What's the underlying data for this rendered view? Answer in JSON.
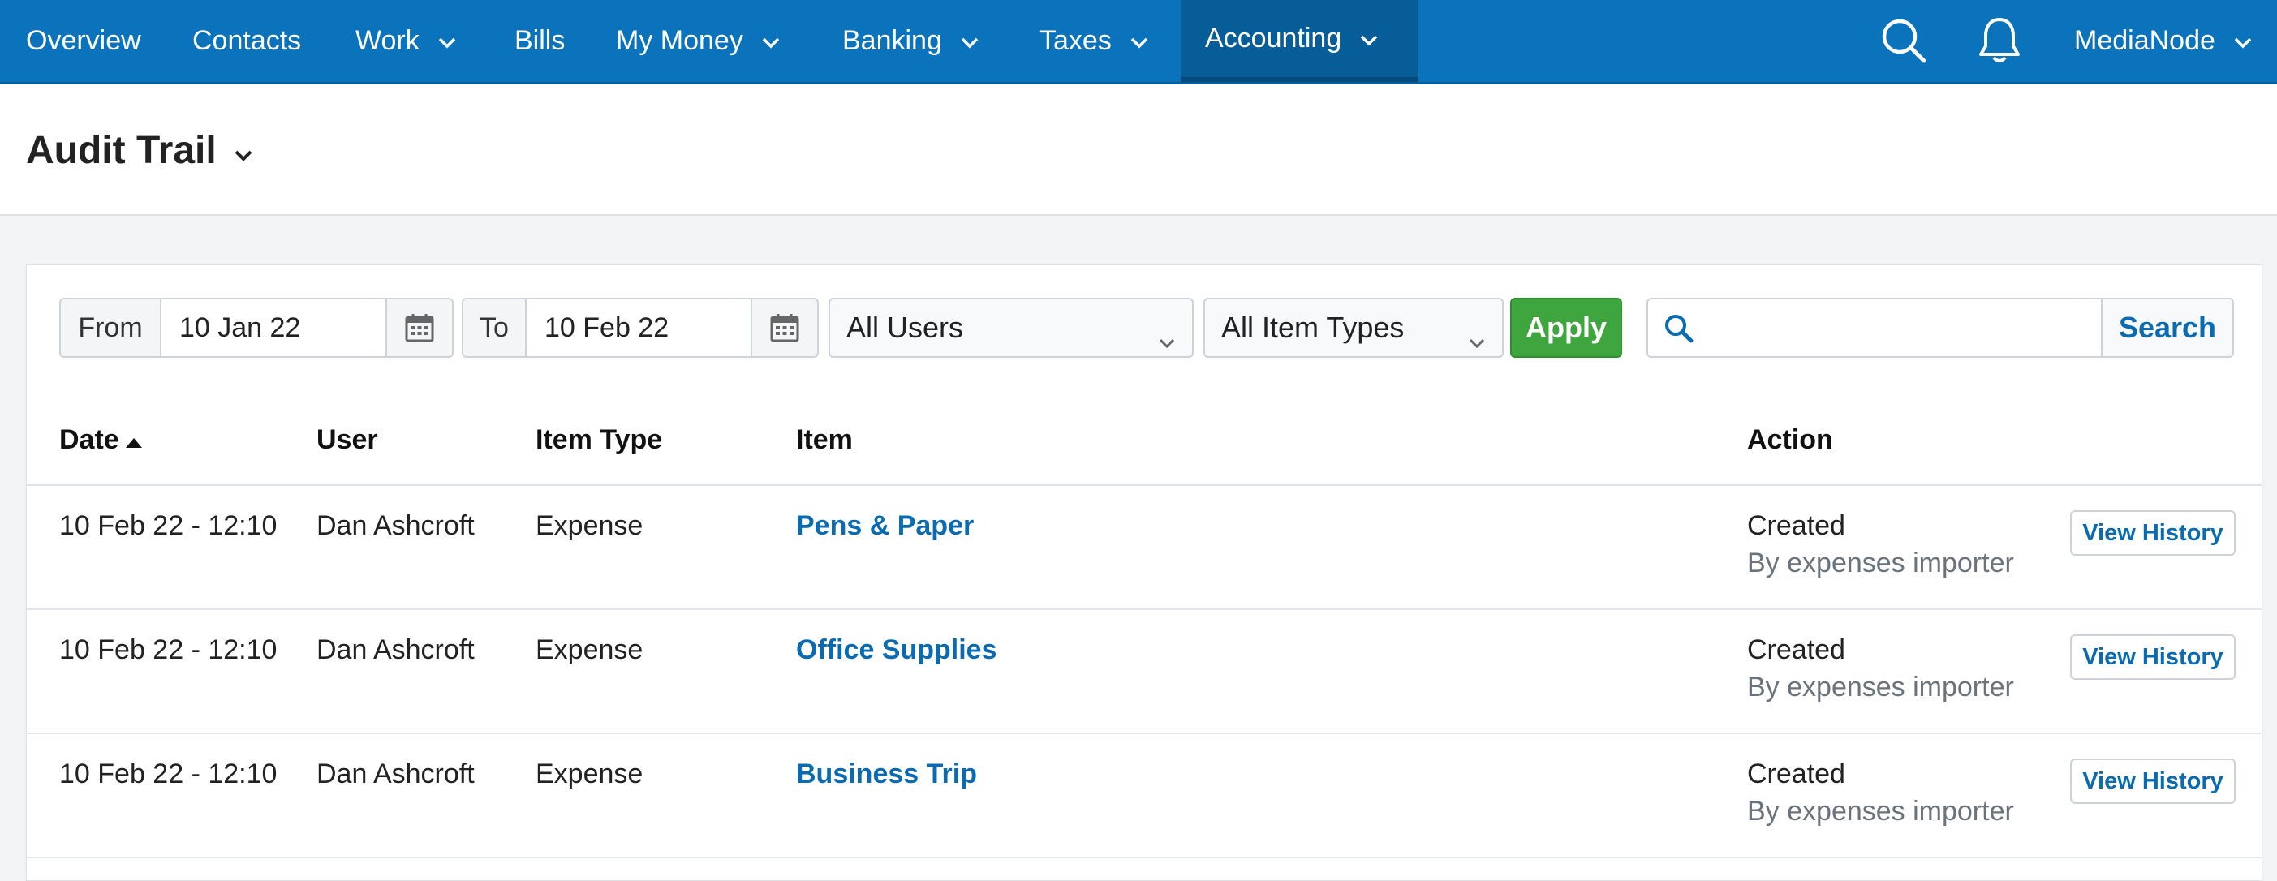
{
  "nav": {
    "items": [
      {
        "label": "Overview",
        "dropdown": false
      },
      {
        "label": "Contacts",
        "dropdown": false
      },
      {
        "label": "Work",
        "dropdown": true
      },
      {
        "label": "Bills",
        "dropdown": false
      },
      {
        "label": "My Money",
        "dropdown": true
      },
      {
        "label": "Banking",
        "dropdown": true
      },
      {
        "label": "Taxes",
        "dropdown": true
      },
      {
        "label": "Accounting",
        "dropdown": true,
        "active": true
      }
    ],
    "account_label": "MediaNode",
    "icons": [
      "search-icon",
      "bell-icon"
    ]
  },
  "page": {
    "title": "Audit Trail"
  },
  "filters": {
    "from_label": "From",
    "from_value": "10 Jan 22",
    "to_label": "To",
    "to_value": "10 Feb 22",
    "users_select": "All Users",
    "item_types_select": "All Item Types",
    "apply_label": "Apply",
    "search_placeholder": "",
    "search_label": "Search"
  },
  "table": {
    "columns": [
      "Date",
      "User",
      "Item Type",
      "Item",
      "Action"
    ],
    "sorted_by": "Date",
    "sort_direction": "ascending",
    "rows": [
      {
        "date": "10 Feb 22 - 12:10",
        "user": "Dan Ashcroft",
        "item_type": "Expense",
        "item": "Pens & Paper",
        "action": "Created",
        "action_detail": "By expenses importer",
        "button": "View History"
      },
      {
        "date": "10 Feb 22 - 12:10",
        "user": "Dan Ashcroft",
        "item_type": "Expense",
        "item": "Office Supplies",
        "action": "Created",
        "action_detail": "By expenses importer",
        "button": "View History"
      },
      {
        "date": "10 Feb 22 - 12:10",
        "user": "Dan Ashcroft",
        "item_type": "Expense",
        "item": "Business Trip",
        "action": "Created",
        "action_detail": "By expenses importer",
        "button": "View History"
      }
    ]
  },
  "colors": {
    "nav_bg": "#0a73bb",
    "nav_active": "#075d98",
    "link": "#0a6bb0",
    "apply_green": "#3fa63f"
  }
}
